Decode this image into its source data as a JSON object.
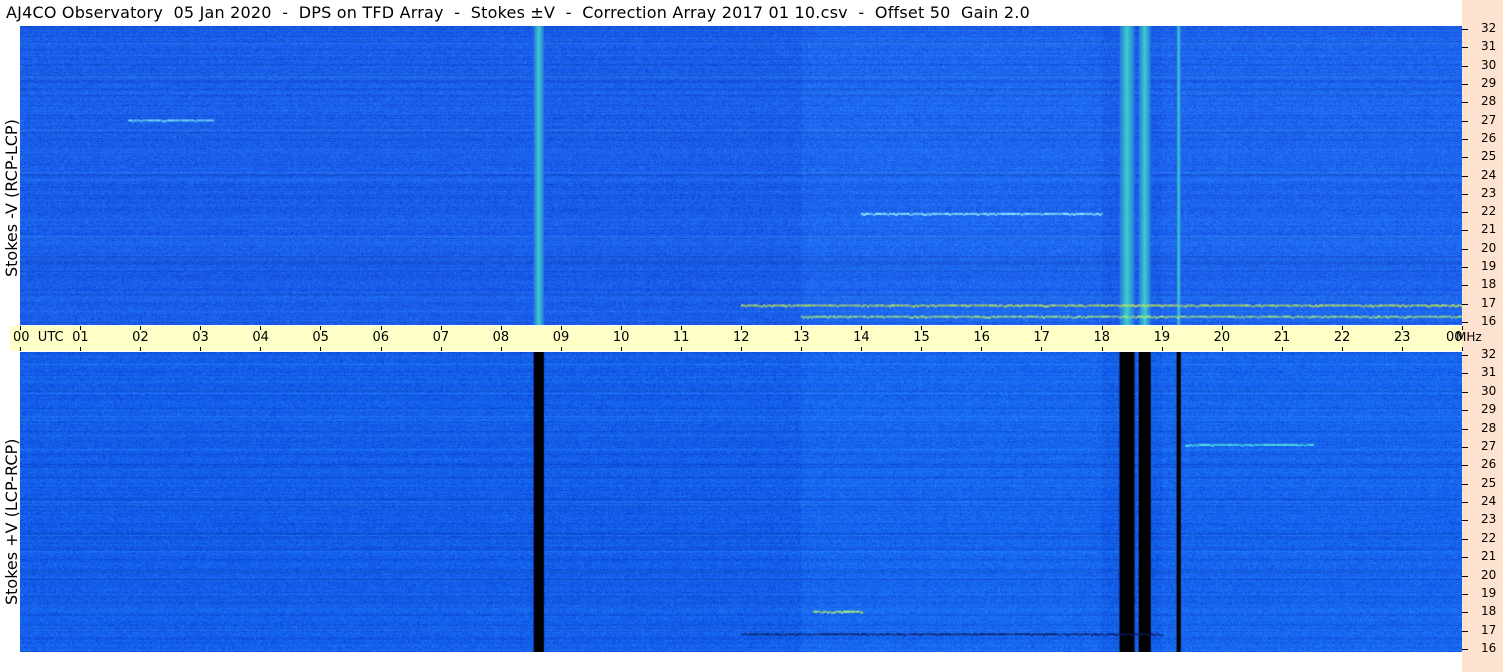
{
  "title": "AJ4CO Observatory  05 Jan 2020  -  DPS on TFD Array  -  Stokes ±V  -  Correction Array 2017 01 10.csv  -  Offset 50  Gain 2.0",
  "colors": {
    "time_axis_bg": "#ffffc8",
    "freq_strip_bg": "#fde3cf",
    "spectrogram_base": "#1a5fe0"
  },
  "chart_data": [
    {
      "type": "heatmap",
      "ylabel": "Stokes -V (RCP-LCP)",
      "x_unit": "UTC",
      "y_unit": "MHz",
      "xlim": [
        0,
        24
      ],
      "ylim": [
        16,
        32
      ],
      "yticks": [
        "32",
        "31",
        "30",
        "29",
        "28",
        "27",
        "26",
        "25",
        "24",
        "23",
        "22",
        "21",
        "20",
        "19",
        "18",
        "17",
        "16"
      ],
      "features": [
        {
          "kind": "vertical_band",
          "start_utc": 8.55,
          "end_utc": 8.72,
          "color": "#3fd0c8"
        },
        {
          "kind": "vertical_band",
          "start_utc": 18.3,
          "end_utc": 18.55,
          "color": "#3fd0c8"
        },
        {
          "kind": "vertical_band",
          "start_utc": 18.62,
          "end_utc": 18.82,
          "color": "#3fd0c8"
        },
        {
          "kind": "vertical_band",
          "start_utc": 19.25,
          "end_utc": 19.32,
          "color": "#3fd0c8"
        },
        {
          "kind": "horizontal_line",
          "freq_mhz": 17.1,
          "start_utc": 12.0,
          "end_utc": 24.0,
          "color": "#c8e850"
        },
        {
          "kind": "horizontal_line",
          "freq_mhz": 16.5,
          "start_utc": 13.0,
          "end_utc": 24.0,
          "color": "#b0f070"
        },
        {
          "kind": "horizontal_line",
          "freq_mhz": 27.0,
          "start_utc": 1.8,
          "end_utc": 3.2,
          "color": "#7ff0ff"
        },
        {
          "kind": "horizontal_line",
          "freq_mhz": 22.0,
          "start_utc": 14.0,
          "end_utc": 18.0,
          "color": "#a0ffff"
        }
      ]
    },
    {
      "type": "heatmap",
      "ylabel": "Stokes +V (LCP-RCP)",
      "x_unit": "UTC",
      "y_unit": "MHz",
      "xlim": [
        0,
        24
      ],
      "ylim": [
        16,
        32
      ],
      "yticks": [
        "32",
        "31",
        "30",
        "29",
        "28",
        "27",
        "26",
        "25",
        "24",
        "23",
        "22",
        "21",
        "20",
        "19",
        "18",
        "17",
        "16"
      ],
      "features": [
        {
          "kind": "vertical_band",
          "start_utc": 8.55,
          "end_utc": 8.72,
          "color": "#000000"
        },
        {
          "kind": "vertical_band",
          "start_utc": 18.3,
          "end_utc": 18.55,
          "color": "#000000"
        },
        {
          "kind": "vertical_band",
          "start_utc": 18.62,
          "end_utc": 18.82,
          "color": "#000000"
        },
        {
          "kind": "vertical_band",
          "start_utc": 19.25,
          "end_utc": 19.32,
          "color": "#000000"
        },
        {
          "kind": "horizontal_line",
          "freq_mhz": 17.0,
          "start_utc": 12.0,
          "end_utc": 19.0,
          "color": "#0a1a60"
        },
        {
          "kind": "horizontal_line",
          "freq_mhz": 27.1,
          "start_utc": 19.4,
          "end_utc": 21.5,
          "color": "#60ffe0"
        },
        {
          "kind": "horizontal_line",
          "freq_mhz": 18.2,
          "start_utc": 13.2,
          "end_utc": 14.0,
          "color": "#c0ff60"
        }
      ]
    }
  ],
  "time_axis": {
    "labels": [
      "00  UTC",
      "01",
      "02",
      "03",
      "04",
      "05",
      "06",
      "07",
      "08",
      "09",
      "10",
      "11",
      "12",
      "13",
      "14",
      "15",
      "16",
      "17",
      "18",
      "19",
      "20",
      "21",
      "22",
      "23",
      "00"
    ],
    "unit": "MHz"
  }
}
